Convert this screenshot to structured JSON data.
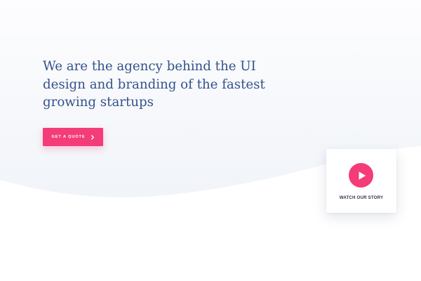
{
  "hero": {
    "headline": "We are the agency behind the UI design and branding of the fastest growing startups",
    "cta_label": "GET A QUOTE",
    "cta_icon": "chevron-right-icon"
  },
  "video_card": {
    "label": "WATCH OUR STORY",
    "icon": "play-icon"
  },
  "colors": {
    "accent": "#f33c78",
    "headline": "#34538a",
    "hero_background": "#f4f7fb",
    "page_background": "#ffffff",
    "card_label": "#2c3446"
  }
}
